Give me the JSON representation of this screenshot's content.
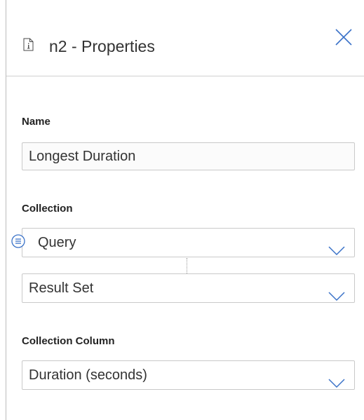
{
  "header": {
    "title": "n2 - Properties",
    "icon": "document-info-icon",
    "close_icon": "close-icon"
  },
  "name_field": {
    "label": "Name",
    "value": "Longest Duration"
  },
  "collection": {
    "label": "Collection",
    "source": {
      "value": "Query",
      "badge_icon": "list-icon"
    },
    "subset": {
      "value": "Result Set"
    }
  },
  "collection_column": {
    "label": "Collection Column",
    "value": "Duration (seconds)"
  },
  "colors": {
    "accent": "#3a72c8",
    "border": "#c9c9c9",
    "text": "#333333"
  }
}
